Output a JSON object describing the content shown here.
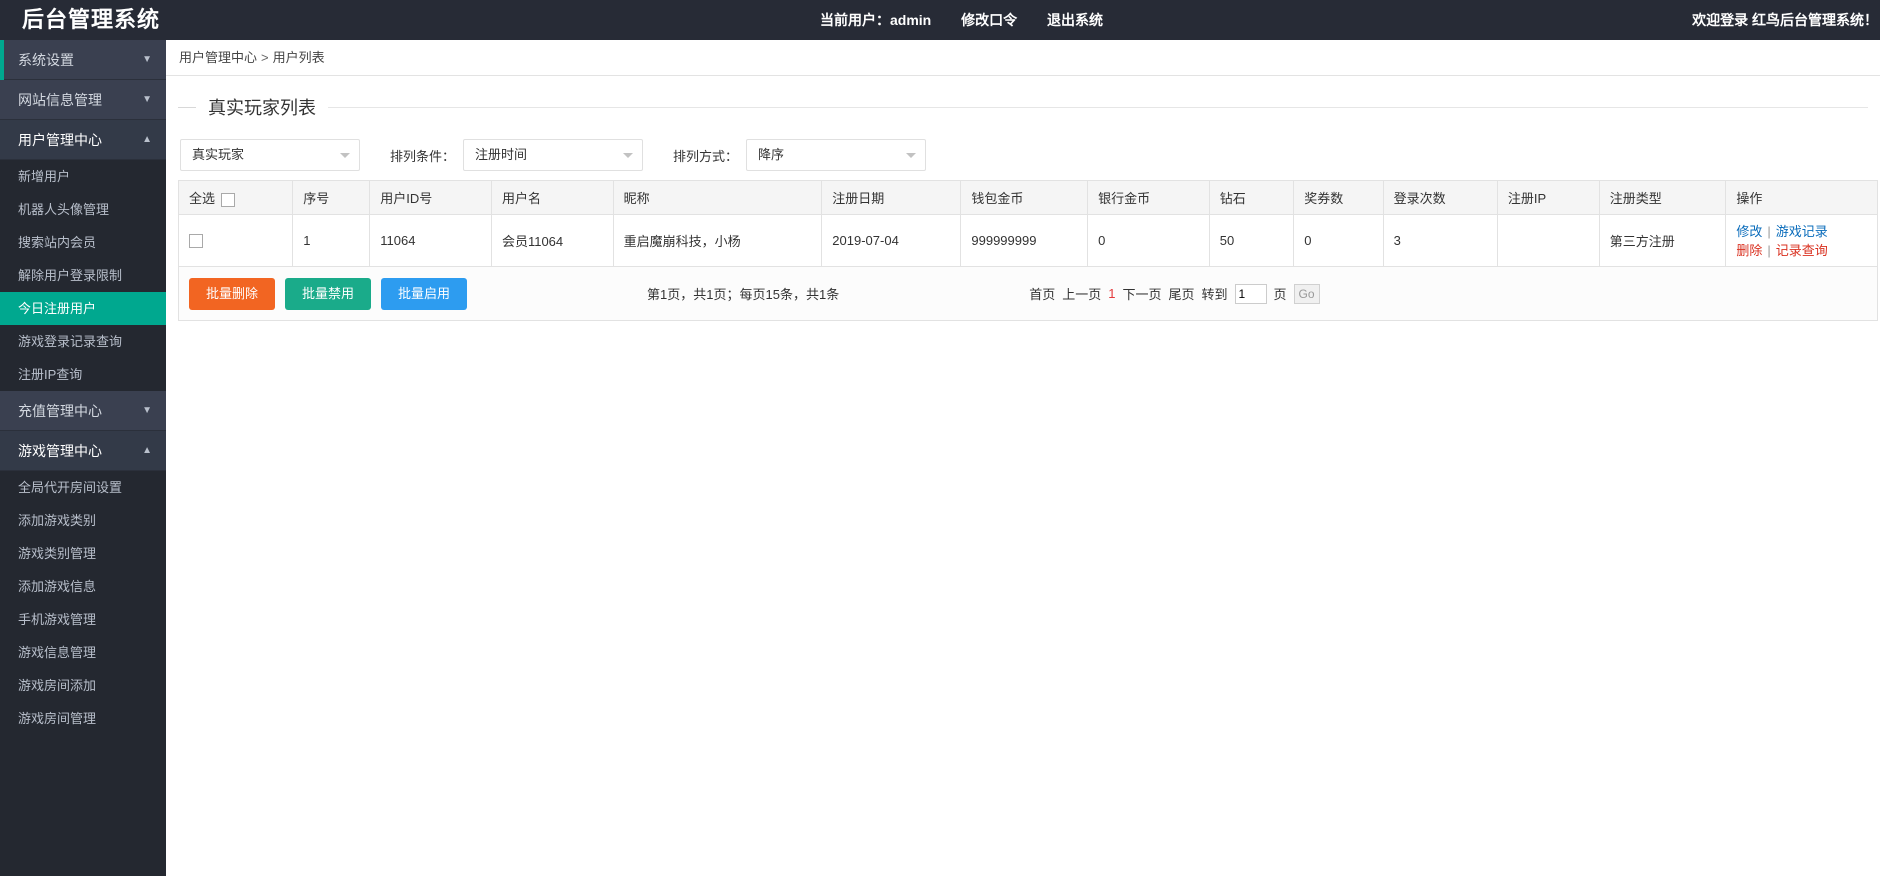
{
  "topbar": {
    "logo": "后台管理系统",
    "current_user_label": "当前用户：admin",
    "change_password": "修改口令",
    "logout": "退出系统",
    "welcome": "欢迎登录 红鸟后台管理系统！"
  },
  "sidebar": {
    "groups": [
      {
        "label": "系统设置",
        "caret": "▼",
        "open": false,
        "accent": true,
        "items": []
      },
      {
        "label": "网站信息管理",
        "caret": "▼",
        "open": false,
        "accent": false,
        "items": []
      },
      {
        "label": "用户管理中心",
        "caret": "▲",
        "open": true,
        "accent": false,
        "items": [
          {
            "label": "新增用户",
            "active": false
          },
          {
            "label": "机器人头像管理",
            "active": false
          },
          {
            "label": "搜索站内会员",
            "active": false
          },
          {
            "label": "解除用户登录限制",
            "active": false
          },
          {
            "label": "今日注册用户",
            "active": true
          },
          {
            "label": "游戏登录记录查询",
            "active": false
          },
          {
            "label": "注册IP查询",
            "active": false
          }
        ]
      },
      {
        "label": "充值管理中心",
        "caret": "▼",
        "open": false,
        "accent": false,
        "items": []
      },
      {
        "label": "游戏管理中心",
        "caret": "▲",
        "open": true,
        "accent": false,
        "items": [
          {
            "label": "全局代开房间设置",
            "active": false
          },
          {
            "label": "添加游戏类别",
            "active": false
          },
          {
            "label": "游戏类别管理",
            "active": false
          },
          {
            "label": "添加游戏信息",
            "active": false
          },
          {
            "label": "手机游戏管理",
            "active": false
          },
          {
            "label": "游戏信息管理",
            "active": false
          },
          {
            "label": "游戏房间添加",
            "active": false
          },
          {
            "label": "游戏房间管理",
            "active": false
          }
        ]
      }
    ]
  },
  "breadcrumb": {
    "parent": "用户管理中心",
    "separator": ">",
    "current": "用户列表"
  },
  "panel": {
    "title": "真实玩家列表"
  },
  "filters": {
    "player_type": {
      "value": "真实玩家"
    },
    "sort_field_label": "排列条件：",
    "sort_field": {
      "value": "注册时间"
    },
    "sort_order_label": "排列方式：",
    "sort_order": {
      "value": "降序"
    }
  },
  "table": {
    "headers": [
      "全选",
      "序号",
      "用户ID号",
      "用户名",
      "昵称",
      "注册日期",
      "钱包金币",
      "银行金币",
      "钻石",
      "奖券数",
      "登录次数",
      "注册IP",
      "注册类型",
      "操作"
    ],
    "rows": [
      {
        "index": "1",
        "user_id": "11064",
        "username": "会员11064",
        "nickname": "重启魔崩科技，小杨",
        "reg_date": "2019-07-04",
        "wallet_coin": "999999999",
        "bank_coin": "0",
        "diamond": "50",
        "ticket": "0",
        "login_count": "3",
        "reg_ip": "",
        "reg_type": "第三方注册",
        "actions": {
          "edit": "修改",
          "game_record": "游戏记录",
          "delete": "删除",
          "query_record": "记录查询",
          "sep": "|"
        }
      }
    ]
  },
  "footer": {
    "buttons": {
      "batch_delete": "批量删除",
      "batch_disable": "批量禁用",
      "batch_enable": "批量启用"
    },
    "summary": "第1页，共1页；每页15条，共1条",
    "pager": {
      "first": "首页",
      "prev": "上一页",
      "current": "1",
      "next": "下一页",
      "last": "尾页",
      "jump_label": "转到",
      "jump_value": "1",
      "page_unit": "页",
      "go": "Go"
    }
  },
  "colors": {
    "accent_teal": "#00a88f",
    "topbar_bg": "#272b36",
    "sidebar_bg": "#242830",
    "btn_delete": "#f26522",
    "btn_disable": "#1aab8a",
    "btn_enable": "#2d9cf0",
    "link_blue": "#0a6cbb",
    "link_red": "#d9301f"
  }
}
